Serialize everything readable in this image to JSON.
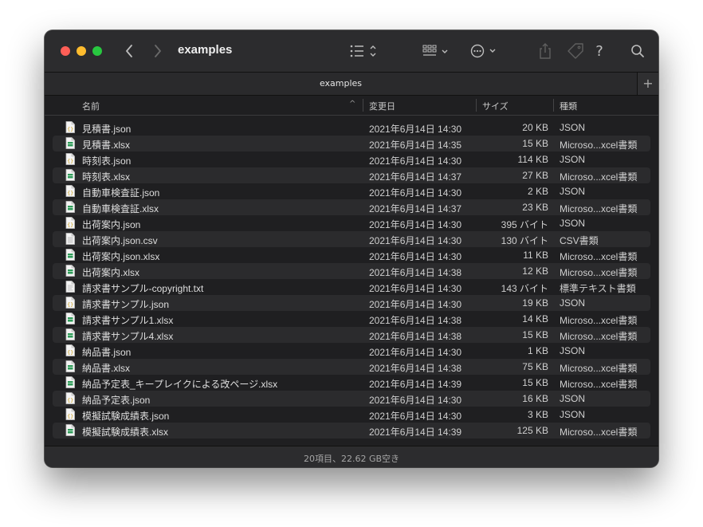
{
  "window": {
    "title": "examples"
  },
  "tab": {
    "label": "examples",
    "add_label": "+"
  },
  "columns": {
    "name": "名前",
    "date": "変更日",
    "size": "サイズ",
    "kind": "種類"
  },
  "files": [
    {
      "name": "見積書.json",
      "date": "2021年6月14日 14:30",
      "size": "20 KB",
      "kind": "JSON",
      "icon": "json-file-icon"
    },
    {
      "name": "見積書.xlsx",
      "date": "2021年6月14日 14:35",
      "size": "15 KB",
      "kind": "Microso...xcel書類",
      "icon": "xlsx-file-icon"
    },
    {
      "name": "時刻表.json",
      "date": "2021年6月14日 14:30",
      "size": "114 KB",
      "kind": "JSON",
      "icon": "json-file-icon"
    },
    {
      "name": "時刻表.xlsx",
      "date": "2021年6月14日 14:37",
      "size": "27 KB",
      "kind": "Microso...xcel書類",
      "icon": "xlsx-file-icon"
    },
    {
      "name": "自動車検査証.json",
      "date": "2021年6月14日 14:30",
      "size": "2 KB",
      "kind": "JSON",
      "icon": "json-file-icon"
    },
    {
      "name": "自動車検査証.xlsx",
      "date": "2021年6月14日 14:37",
      "size": "23 KB",
      "kind": "Microso...xcel書類",
      "icon": "xlsx-file-icon"
    },
    {
      "name": "出荷案内.json",
      "date": "2021年6月14日 14:30",
      "size": "395 バイト",
      "kind": "JSON",
      "icon": "json-file-icon"
    },
    {
      "name": "出荷案内.json.csv",
      "date": "2021年6月14日 14:30",
      "size": "130 バイト",
      "kind": "CSV書類",
      "icon": "csv-file-icon"
    },
    {
      "name": "出荷案内.json.xlsx",
      "date": "2021年6月14日 14:30",
      "size": "11 KB",
      "kind": "Microso...xcel書類",
      "icon": "xlsx-file-icon"
    },
    {
      "name": "出荷案内.xlsx",
      "date": "2021年6月14日 14:38",
      "size": "12 KB",
      "kind": "Microso...xcel書類",
      "icon": "xlsx-file-icon"
    },
    {
      "name": "請求書サンプル-copyright.txt",
      "date": "2021年6月14日 14:30",
      "size": "143 バイト",
      "kind": "標準テキスト書類",
      "icon": "text-file-icon"
    },
    {
      "name": "請求書サンプル.json",
      "date": "2021年6月14日 14:30",
      "size": "19 KB",
      "kind": "JSON",
      "icon": "json-file-icon"
    },
    {
      "name": "請求書サンプル1.xlsx",
      "date": "2021年6月14日 14:38",
      "size": "14 KB",
      "kind": "Microso...xcel書類",
      "icon": "xlsx-file-icon"
    },
    {
      "name": "請求書サンプル4.xlsx",
      "date": "2021年6月14日 14:38",
      "size": "15 KB",
      "kind": "Microso...xcel書類",
      "icon": "xlsx-file-icon"
    },
    {
      "name": "納品書.json",
      "date": "2021年6月14日 14:30",
      "size": "1 KB",
      "kind": "JSON",
      "icon": "json-file-icon"
    },
    {
      "name": "納品書.xlsx",
      "date": "2021年6月14日 14:38",
      "size": "75 KB",
      "kind": "Microso...xcel書類",
      "icon": "xlsx-file-icon"
    },
    {
      "name": "納品予定表_キープレイクによる改ページ.xlsx",
      "date": "2021年6月14日 14:39",
      "size": "15 KB",
      "kind": "Microso...xcel書類",
      "icon": "xlsx-file-icon"
    },
    {
      "name": "納品予定表.json",
      "date": "2021年6月14日 14:30",
      "size": "16 KB",
      "kind": "JSON",
      "icon": "json-file-icon"
    },
    {
      "name": "模擬試験成績表.json",
      "date": "2021年6月14日 14:30",
      "size": "3 KB",
      "kind": "JSON",
      "icon": "json-file-icon"
    },
    {
      "name": "模擬試験成績表.xlsx",
      "date": "2021年6月14日 14:39",
      "size": "125 KB",
      "kind": "Microso...xcel書類",
      "icon": "xlsx-file-icon"
    }
  ],
  "status": {
    "text": "20項目、22.62 GB空き"
  },
  "colors": {
    "window_bg": "#1f1f21",
    "toolbar_bg": "#2c2c2e",
    "alt_row": "#2b2b2d",
    "red": "#ff5f57",
    "yellow": "#febc2e",
    "green": "#28c840",
    "json_icon": "#e9c44a",
    "xlsx_icon": "#2e9b58"
  }
}
